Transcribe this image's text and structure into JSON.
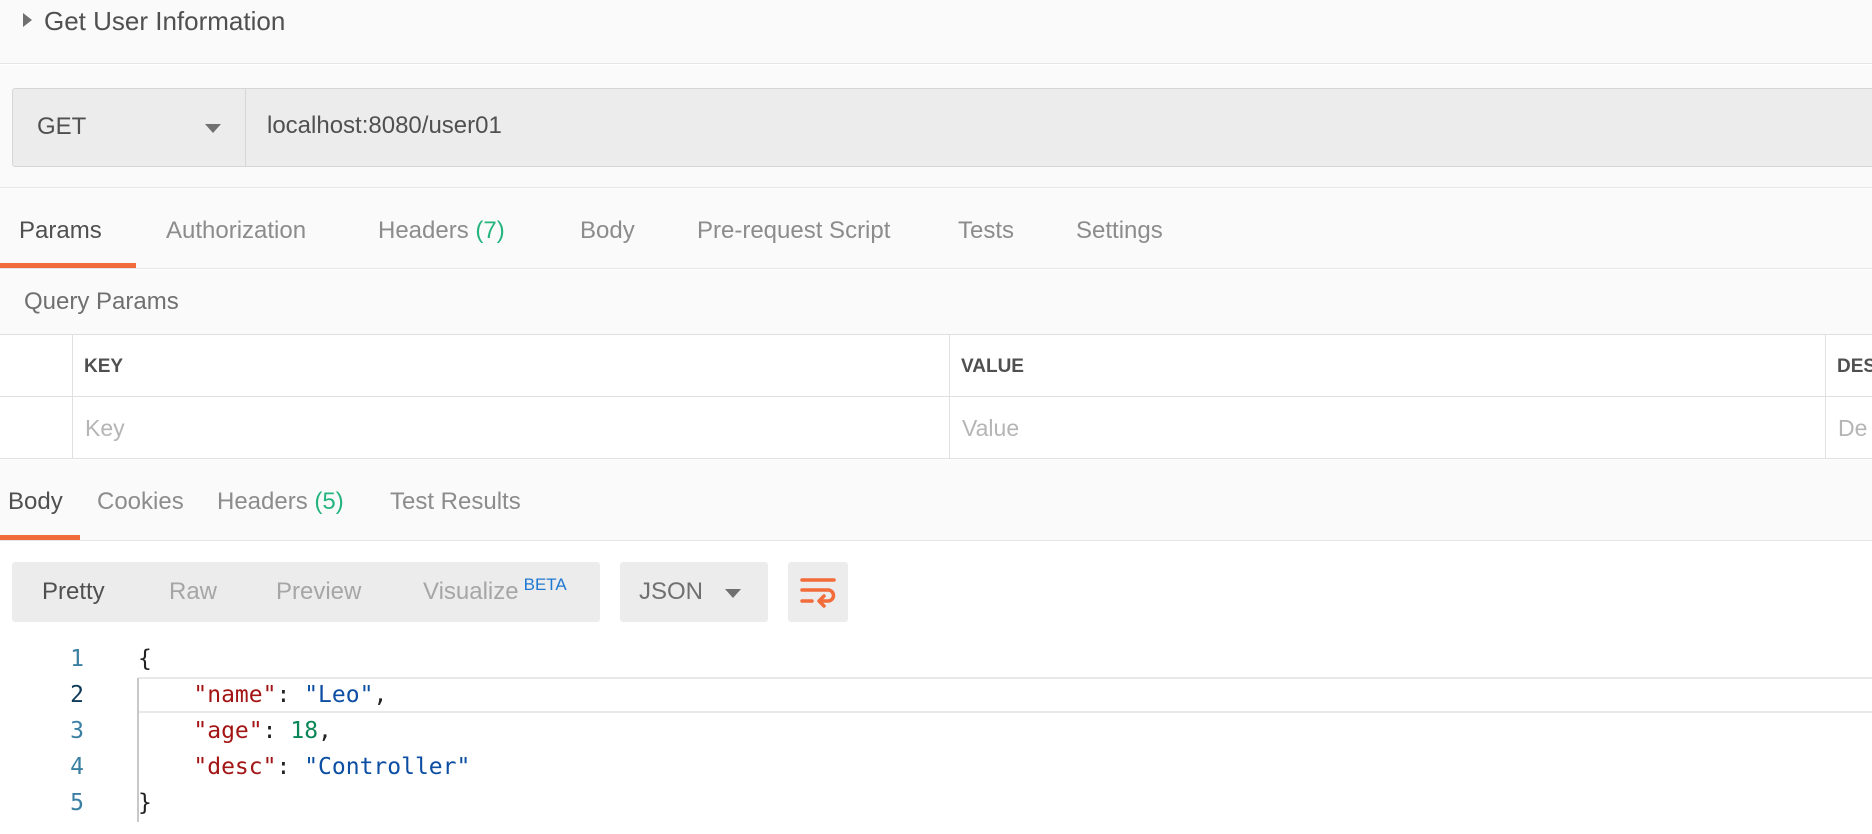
{
  "request": {
    "title": "Get User Information",
    "method": "GET",
    "url": "localhost:8080/user01"
  },
  "request_tabs": [
    {
      "label": "Params",
      "count": "",
      "active": true
    },
    {
      "label": "Authorization",
      "count": "",
      "active": false
    },
    {
      "label": "Headers",
      "count": "(7)",
      "active": false
    },
    {
      "label": "Body",
      "count": "",
      "active": false
    },
    {
      "label": "Pre-request Script",
      "count": "",
      "active": false
    },
    {
      "label": "Tests",
      "count": "",
      "active": false
    },
    {
      "label": "Settings",
      "count": "",
      "active": false
    }
  ],
  "query_params": {
    "title": "Query Params",
    "columns": [
      "KEY",
      "VALUE",
      "DES"
    ],
    "placeholders": [
      "Key",
      "Value",
      "De"
    ]
  },
  "response_tabs": [
    {
      "label": "Body",
      "count": "",
      "active": true
    },
    {
      "label": "Cookies",
      "count": "",
      "active": false
    },
    {
      "label": "Headers",
      "count": "(5)",
      "active": false
    },
    {
      "label": "Test Results",
      "count": "",
      "active": false
    }
  ],
  "view_modes": [
    {
      "label": "Pretty",
      "active": true
    },
    {
      "label": "Raw",
      "active": false
    },
    {
      "label": "Preview",
      "active": false
    },
    {
      "label": "Visualize",
      "active": false
    }
  ],
  "visualize_badge": "BETA",
  "format": "JSON",
  "wrap_icon": "wrap-lines-icon",
  "code": {
    "line_numbers": [
      "1",
      "2",
      "3",
      "4",
      "5"
    ],
    "open_brace": "{",
    "close_brace": "}",
    "fields": [
      {
        "key": "\"name\"",
        "value": "\"Leo\"",
        "type": "string",
        "comma": ","
      },
      {
        "key": "\"age\"",
        "value": "18",
        "type": "number",
        "comma": ","
      },
      {
        "key": "\"desc\"",
        "value": "\"Controller\"",
        "type": "string",
        "comma": ""
      }
    ],
    "colon": ": "
  },
  "colors": {
    "accent": "#f26b3a",
    "count": "#26b47f",
    "beta": "#1f78d1",
    "json_key": "#a31515",
    "json_string": "#0b4ea2",
    "json_number": "#098658"
  }
}
